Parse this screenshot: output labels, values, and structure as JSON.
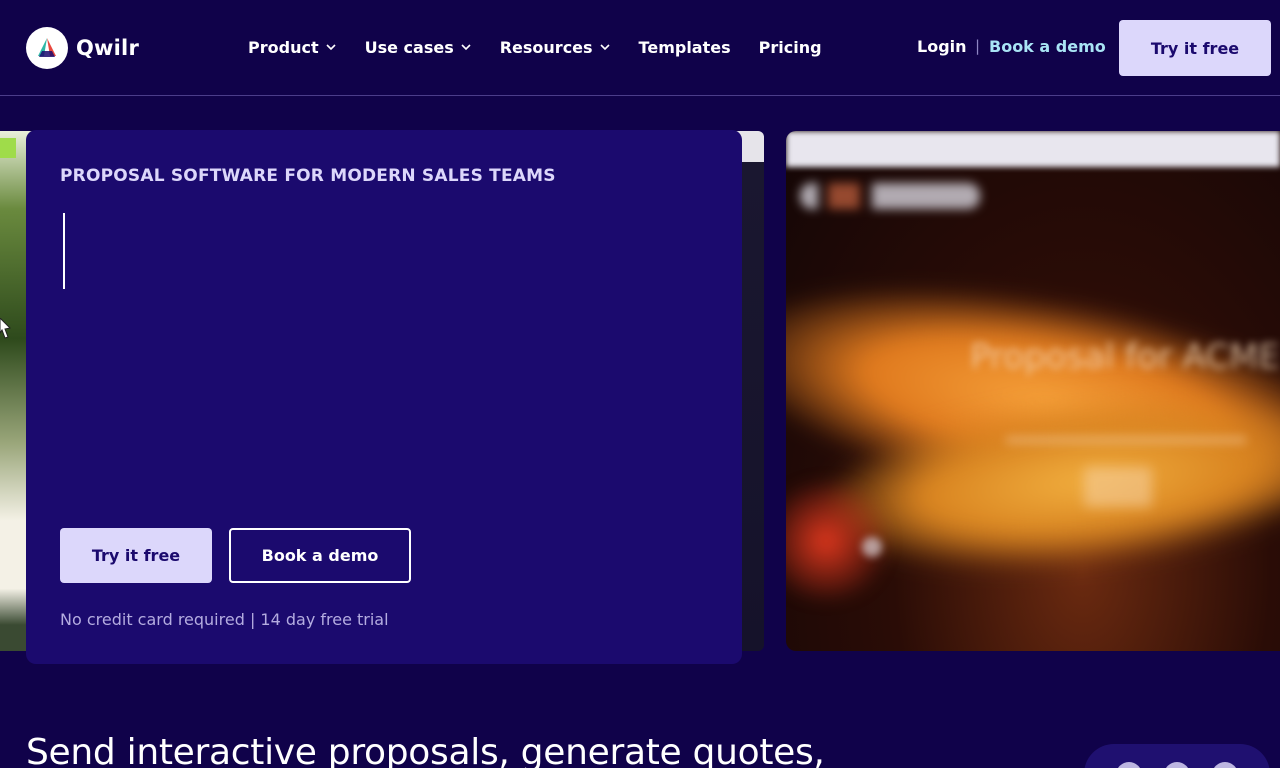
{
  "brand": {
    "name": "Qwilr"
  },
  "nav": {
    "items": [
      {
        "label": "Product",
        "has_dropdown": true
      },
      {
        "label": "Use cases",
        "has_dropdown": true
      },
      {
        "label": "Resources",
        "has_dropdown": true
      },
      {
        "label": "Templates",
        "has_dropdown": false
      },
      {
        "label": "Pricing",
        "has_dropdown": false
      }
    ],
    "login_label": "Login",
    "separator": "|",
    "book_demo_label": "Book a demo",
    "try_free_label": "Try it free"
  },
  "hero": {
    "eyebrow": "PROPOSAL SOFTWARE FOR MODERN SALES TEAMS",
    "try_free_label": "Try it free",
    "book_demo_label": "Book a demo",
    "note": "No credit card required | 14 day free trial"
  },
  "preview": {
    "title": "Proposal for ACME"
  },
  "section": {
    "headline": "Send interactive proposals, generate quotes,"
  },
  "colors": {
    "background": "#10024a",
    "card": "#1b0a6e",
    "primary_button": "#dcd7fb",
    "accent_link": "#a9e4f5"
  },
  "icons": [
    "qwilr-logo-icon",
    "chevron-down-icon",
    "mouse-cursor-icon"
  ]
}
